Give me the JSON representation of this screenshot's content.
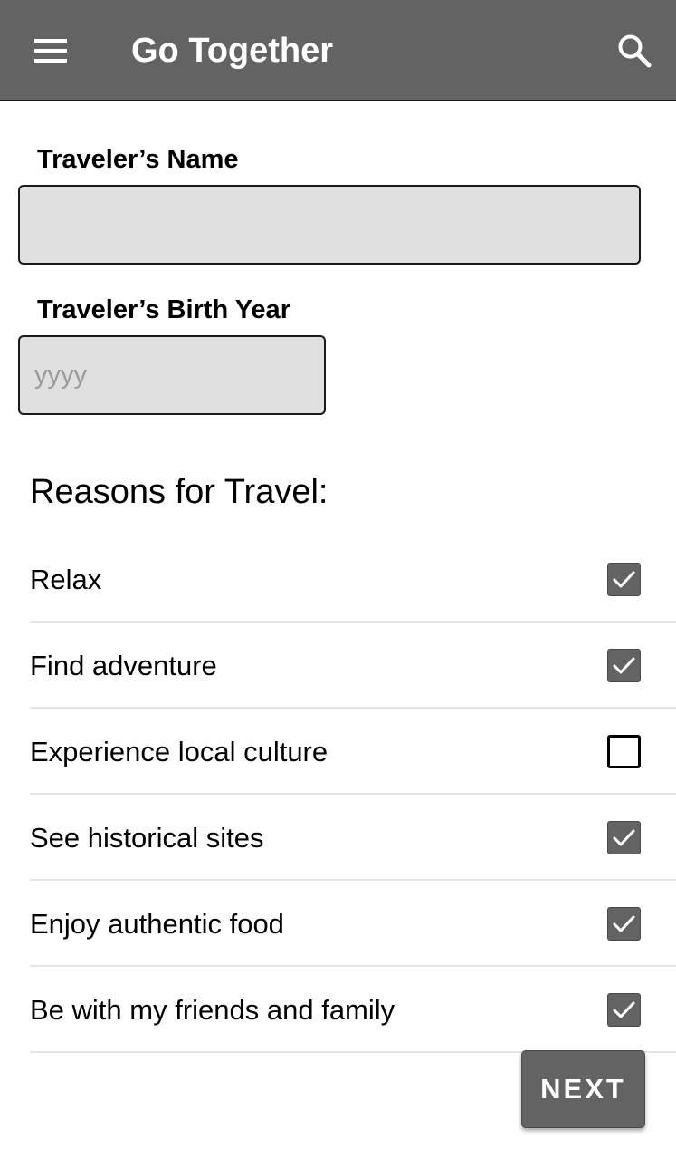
{
  "app_bar": {
    "title": "Go Together",
    "menu_icon": "hamburger-menu-icon",
    "search_icon": "search-icon",
    "background_color": "#636363"
  },
  "form": {
    "name_label": "Traveler’s Name",
    "name_value": "",
    "birth_year_label": "Traveler’s Birth Year",
    "birth_year_value": "",
    "birth_year_placeholder": "yyyy"
  },
  "reasons": {
    "title": "Reasons for Travel:",
    "items": [
      {
        "label": "Relax",
        "checked": true
      },
      {
        "label": "Find adventure",
        "checked": true
      },
      {
        "label": "Experience local culture",
        "checked": false
      },
      {
        "label": "See historical sites",
        "checked": true
      },
      {
        "label": "Enjoy authentic food",
        "checked": true
      },
      {
        "label": "Be with my friends and family",
        "checked": true
      }
    ]
  },
  "next_button": {
    "label": "NEXT"
  }
}
